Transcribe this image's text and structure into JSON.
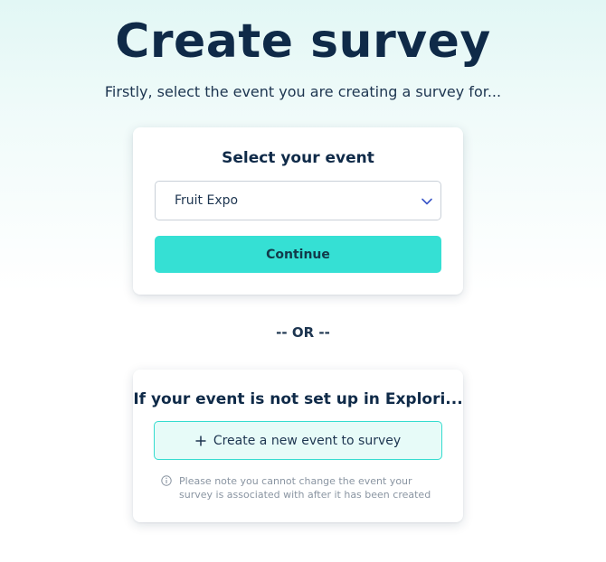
{
  "page": {
    "title": "Create survey",
    "subtitle": "Firstly, select the event you are creating a survey for..."
  },
  "select_card": {
    "heading": "Select your event",
    "select": {
      "value": "Fruit Expo",
      "icon": "chevron-down-icon"
    },
    "continue_label": "Continue"
  },
  "divider": "-- OR --",
  "create_card": {
    "heading": "If your event is not set up in Explori...",
    "create_label": "Create a new event to survey",
    "create_icon": "plus-icon",
    "note_icon": "info-icon",
    "note": "Please note you cannot change the event your survey is associated with after it has been created"
  },
  "colors": {
    "primary": "#0f2a48",
    "accent": "#35e0d4",
    "accent_light": "#e7fbf8",
    "muted_text": "#8a95a2"
  }
}
